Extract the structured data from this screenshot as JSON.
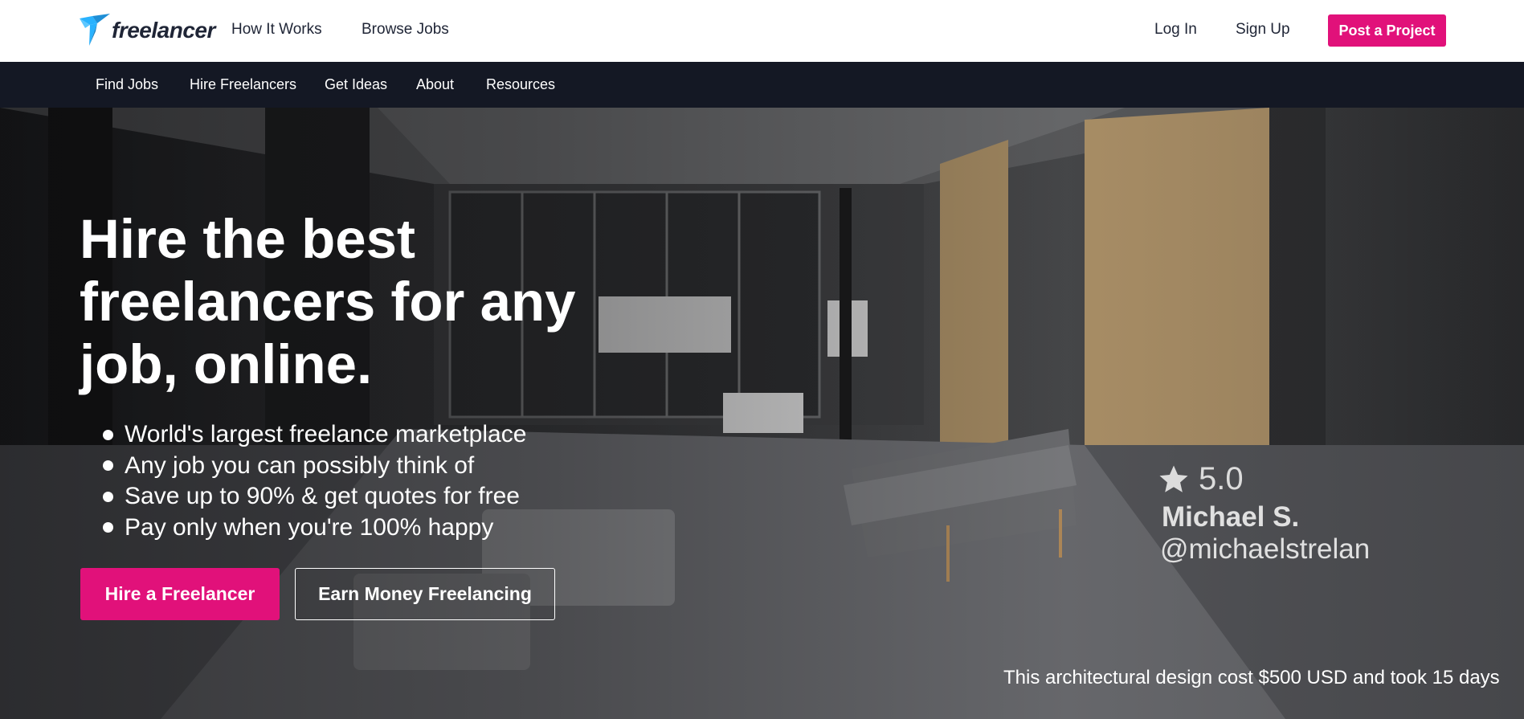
{
  "brand": {
    "logo_text": "freelancer",
    "icon": "freelancer-bird-logo",
    "accent_color": "#e1117a",
    "logo_color": "#29b2fe",
    "subnav_bg": "#141824"
  },
  "header": {
    "nav_left": [
      "How It Works",
      "Browse Jobs"
    ],
    "login": "Log In",
    "signup": "Sign Up",
    "post_project": "Post a Project"
  },
  "subnav": {
    "items": [
      "Find Jobs",
      "Hire Freelancers",
      "Get Ideas",
      "About",
      "Resources"
    ]
  },
  "hero": {
    "headline": "Hire the best freelancers for any job, online.",
    "bullets": [
      "World's largest freelance marketplace",
      "Any job you can possibly think of",
      "Save up to 90% & get quotes for free",
      "Pay only when you're 100% happy"
    ],
    "primary_cta": "Hire a Freelancer",
    "secondary_cta": "Earn Money Freelancing",
    "rating": "5.0",
    "rating_icon": "star-icon",
    "author_name": "Michael S.",
    "author_handle": "@michaelstrelan",
    "caption": "This architectural design cost $500 USD and took 15 days"
  }
}
